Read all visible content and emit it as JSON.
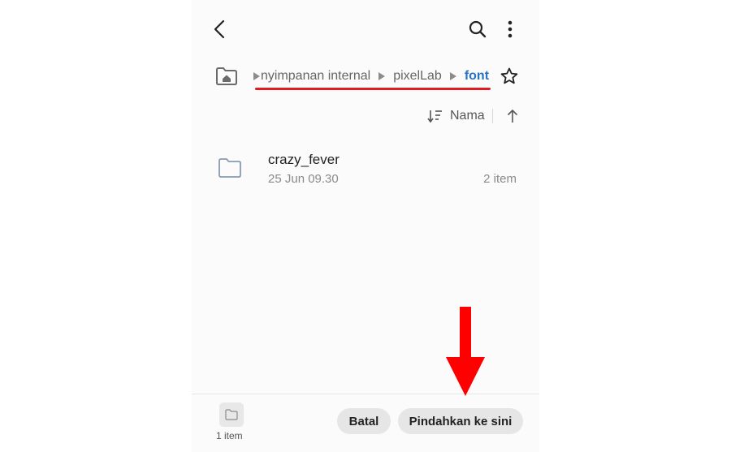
{
  "breadcrumb": {
    "items": [
      {
        "label": "nyimpanan internal"
      },
      {
        "label": "pixelLab"
      },
      {
        "label": "font"
      }
    ]
  },
  "sort": {
    "label": "Nama"
  },
  "files": [
    {
      "name": "crazy_fever",
      "date": "25 Jun 09.30",
      "count": "2 item"
    }
  ],
  "bottom_bar": {
    "selection_count": "1 item",
    "cancel_label": "Batal",
    "move_here_label": "Pindahkan ke sini"
  },
  "colors": {
    "accent": "#2a72c4",
    "annotation_red": "#ff0000",
    "underline_red": "#e11b22"
  }
}
